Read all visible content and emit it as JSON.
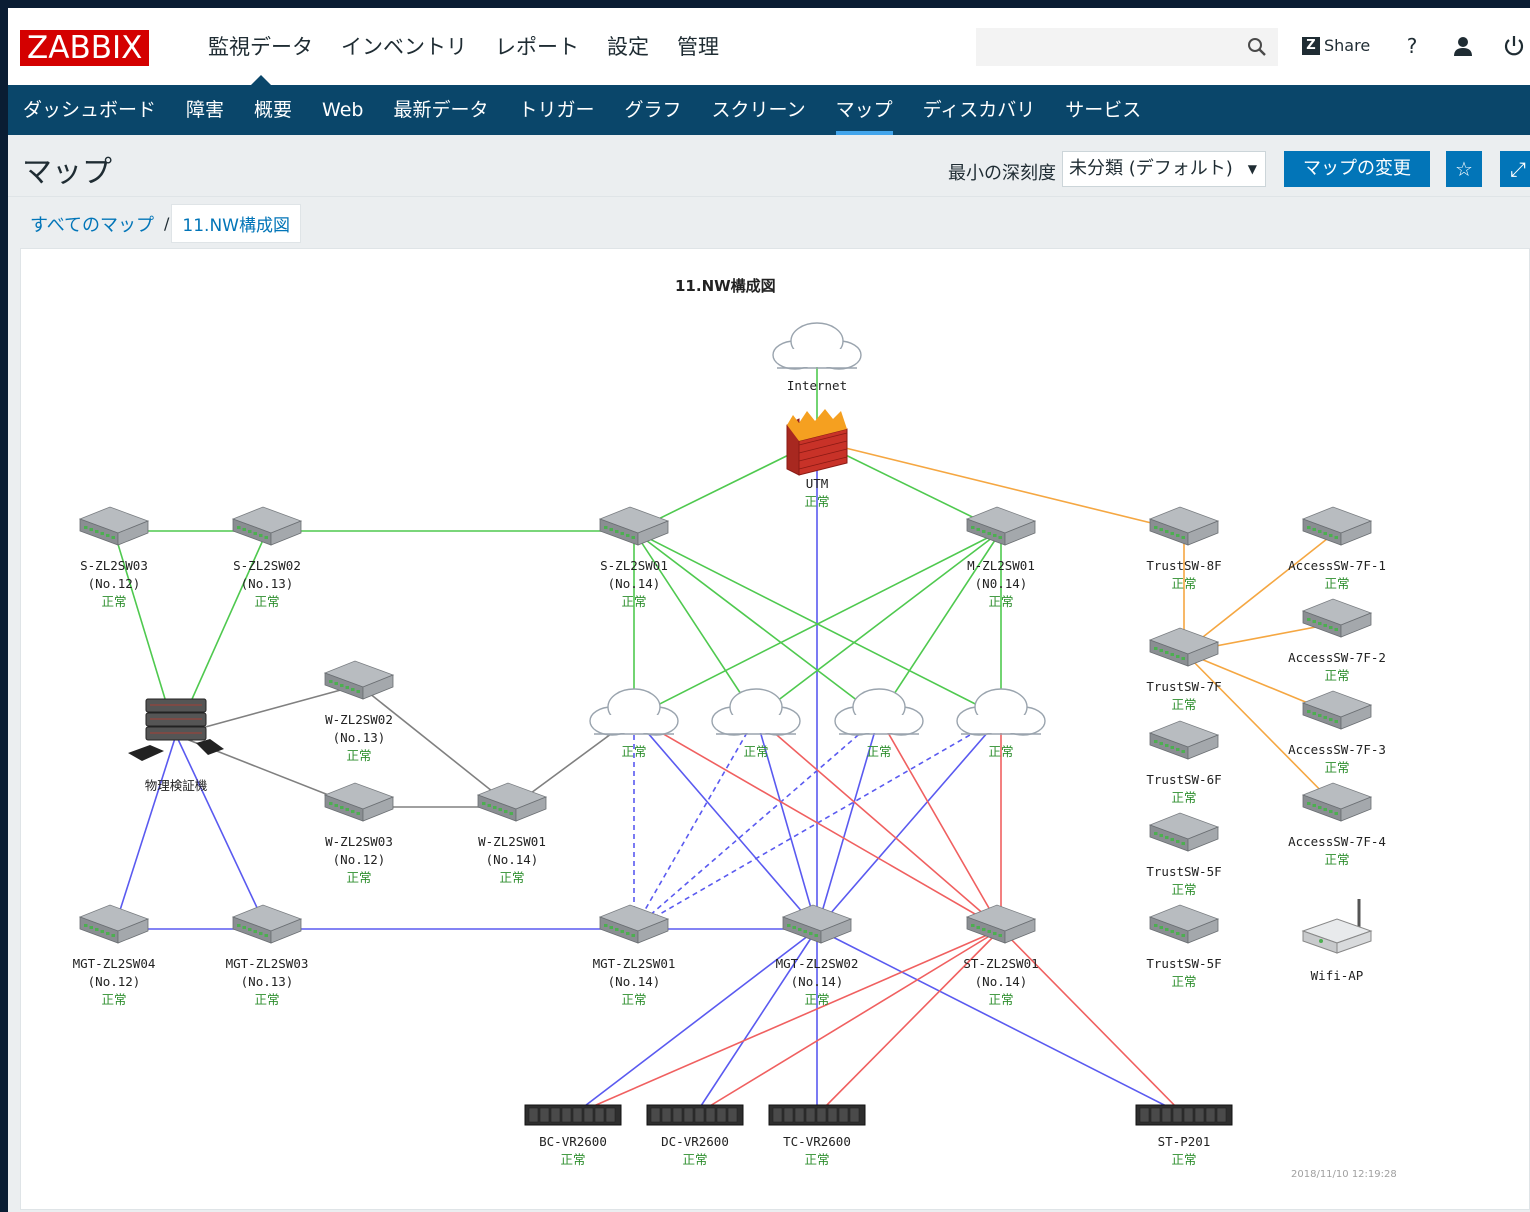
{
  "app": {
    "logo": "ZABBIX",
    "main_menu": [
      "監視データ",
      "インベントリ",
      "レポート",
      "設定",
      "管理"
    ],
    "main_menu_active": 0,
    "search_placeholder": "",
    "share_label": "Share",
    "help_label": "?"
  },
  "sub_menu": {
    "items": [
      "ダッシュボード",
      "障害",
      "概要",
      "Web",
      "最新データ",
      "トリガー",
      "グラフ",
      "スクリーン",
      "マップ",
      "ディスカバリ",
      "サービス"
    ],
    "active": 8
  },
  "header": {
    "title": "マップ",
    "severity_label": "最小の深刻度",
    "severity_value": "未分類 (デフォルト)",
    "change_map_button": "マップの変更"
  },
  "breadcrumb": {
    "all_maps": "すべてのマップ",
    "separator": "/",
    "current": "11.NW構成図"
  },
  "map": {
    "title": "11.NW構成図",
    "timestamp": "2018/11/10 12:19:28",
    "status_ok": "正常",
    "colors": {
      "green": "#4fc94f",
      "orange": "#f5a742",
      "blue": "#5a5af0",
      "red": "#f06060",
      "gray": "#808080",
      "status": "#2f8f2f"
    },
    "nodes": [
      {
        "id": "internet",
        "type": "cloud",
        "lines": [
          "Internet"
        ],
        "status": false
      },
      {
        "id": "utm",
        "type": "firewall",
        "lines": [
          "UTM"
        ],
        "status": true
      },
      {
        "id": "s3",
        "type": "switch",
        "lines": [
          "S-ZL2SW03",
          "(No.12)"
        ],
        "status": true
      },
      {
        "id": "s2",
        "type": "switch",
        "lines": [
          "S-ZL2SW02",
          "(No.13)"
        ],
        "status": true
      },
      {
        "id": "s1",
        "type": "switch",
        "lines": [
          "S-ZL2SW01",
          "(No.14)"
        ],
        "status": true
      },
      {
        "id": "m1",
        "type": "switch",
        "lines": [
          "M-ZL2SW01",
          "(N0.14)"
        ],
        "status": true
      },
      {
        "id": "t8",
        "type": "switch",
        "lines": [
          "TrustSW-8F"
        ],
        "status": true
      },
      {
        "id": "a1",
        "type": "switch",
        "lines": [
          "AccessSW-7F-1"
        ],
        "status": true
      },
      {
        "id": "a2",
        "type": "switch",
        "lines": [
          "AccessSW-7F-2"
        ],
        "status": true
      },
      {
        "id": "t7",
        "type": "switch",
        "lines": [
          "TrustSW-7F"
        ],
        "status": true
      },
      {
        "id": "a3",
        "type": "switch",
        "lines": [
          "AccessSW-7F-3"
        ],
        "status": true
      },
      {
        "id": "t6",
        "type": "switch",
        "lines": [
          "TrustSW-6F"
        ],
        "status": true
      },
      {
        "id": "a4",
        "type": "switch",
        "lines": [
          "AccessSW-7F-4"
        ],
        "status": true
      },
      {
        "id": "t5a",
        "type": "switch",
        "lines": [
          "TrustSW-5F"
        ],
        "status": true
      },
      {
        "id": "t5b",
        "type": "switch",
        "lines": [
          "TrustSW-5F"
        ],
        "status": true
      },
      {
        "id": "wifi",
        "type": "router",
        "lines": [
          "Wifi-AP"
        ],
        "status": false
      },
      {
        "id": "phys",
        "type": "server",
        "lines": [
          "物理検証機"
        ],
        "status": false
      },
      {
        "id": "w2",
        "type": "switch",
        "lines": [
          "W-ZL2SW02",
          "(No.13)"
        ],
        "status": true
      },
      {
        "id": "w3",
        "type": "switch",
        "lines": [
          "W-ZL2SW03",
          "(No.12)"
        ],
        "status": true
      },
      {
        "id": "w1",
        "type": "switch",
        "lines": [
          "W-ZL2SW01",
          "(No.14)"
        ],
        "status": true
      },
      {
        "id": "c1",
        "type": "cloud",
        "lines": [],
        "status": true
      },
      {
        "id": "c2",
        "type": "cloud",
        "lines": [],
        "status": true
      },
      {
        "id": "c3",
        "type": "cloud",
        "lines": [],
        "status": true
      },
      {
        "id": "c4",
        "type": "cloud",
        "lines": [],
        "status": true
      },
      {
        "id": "mg4",
        "type": "switch",
        "lines": [
          "MGT-ZL2SW04",
          "(No.12)"
        ],
        "status": true
      },
      {
        "id": "mg3",
        "type": "switch",
        "lines": [
          "MGT-ZL2SW03",
          "(No.13)"
        ],
        "status": true
      },
      {
        "id": "mg1",
        "type": "switch",
        "lines": [
          "MGT-ZL2SW01",
          "(No.14)"
        ],
        "status": true
      },
      {
        "id": "mg2",
        "type": "switch",
        "lines": [
          "MGT-ZL2SW02",
          "(No.14)"
        ],
        "status": true
      },
      {
        "id": "st1",
        "type": "switch",
        "lines": [
          "ST-ZL2SW01",
          "(No.14)"
        ],
        "status": true
      },
      {
        "id": "bc",
        "type": "rack",
        "lines": [
          "BC-VR2600"
        ],
        "status": true
      },
      {
        "id": "dc",
        "type": "rack",
        "lines": [
          "DC-VR2600"
        ],
        "status": true
      },
      {
        "id": "tc",
        "type": "rack",
        "lines": [
          "TC-VR2600"
        ],
        "status": true
      },
      {
        "id": "stp",
        "type": "rack",
        "lines": [
          "ST-P201"
        ],
        "status": true
      }
    ],
    "links": [
      [
        "internet",
        "utm",
        "green",
        false
      ],
      [
        "utm",
        "s1",
        "green",
        false
      ],
      [
        "utm",
        "m1",
        "green",
        false
      ],
      [
        "utm",
        "t8",
        "orange",
        false
      ],
      [
        "utm",
        "mg2",
        "blue",
        false
      ],
      [
        "s3",
        "s2",
        "green",
        false
      ],
      [
        "s2",
        "s1",
        "green",
        false
      ],
      [
        "s3",
        "phys",
        "green",
        false
      ],
      [
        "s2",
        "phys",
        "green",
        false
      ],
      [
        "s1",
        "c1",
        "green",
        false
      ],
      [
        "s1",
        "c2",
        "green",
        false
      ],
      [
        "s1",
        "c3",
        "green",
        false
      ],
      [
        "s1",
        "c4",
        "green",
        false
      ],
      [
        "m1",
        "c1",
        "green",
        false
      ],
      [
        "m1",
        "c2",
        "green",
        false
      ],
      [
        "m1",
        "c3",
        "green",
        false
      ],
      [
        "m1",
        "c4",
        "green",
        false
      ],
      [
        "t8",
        "t7",
        "orange",
        false
      ],
      [
        "t7",
        "a1",
        "orange",
        false
      ],
      [
        "t7",
        "a2",
        "orange",
        false
      ],
      [
        "t7",
        "a3",
        "orange",
        false
      ],
      [
        "t7",
        "a4",
        "orange",
        false
      ],
      [
        "phys",
        "w2",
        "gray",
        false
      ],
      [
        "phys",
        "w3",
        "gray",
        false
      ],
      [
        "w2",
        "w1",
        "gray",
        false
      ],
      [
        "w3",
        "w1",
        "gray",
        false
      ],
      [
        "w1",
        "c1",
        "gray",
        false
      ],
      [
        "phys",
        "mg4",
        "blue",
        false
      ],
      [
        "phys",
        "mg3",
        "blue",
        false
      ],
      [
        "mg4",
        "mg3",
        "blue",
        false
      ],
      [
        "mg3",
        "mg1",
        "blue",
        false
      ],
      [
        "mg1",
        "mg2",
        "blue",
        false
      ],
      [
        "c1",
        "mg1",
        "blue",
        true
      ],
      [
        "c2",
        "mg1",
        "blue",
        true
      ],
      [
        "c3",
        "mg1",
        "blue",
        true
      ],
      [
        "c4",
        "mg1",
        "blue",
        true
      ],
      [
        "c1",
        "mg2",
        "blue",
        false
      ],
      [
        "c2",
        "mg2",
        "blue",
        false
      ],
      [
        "c3",
        "mg2",
        "blue",
        false
      ],
      [
        "c4",
        "mg2",
        "blue",
        false
      ],
      [
        "c1",
        "st1",
        "red",
        false
      ],
      [
        "c2",
        "st1",
        "red",
        false
      ],
      [
        "c3",
        "st1",
        "red",
        false
      ],
      [
        "c4",
        "st1",
        "red",
        false
      ],
      [
        "mg2",
        "bc",
        "blue",
        false
      ],
      [
        "mg2",
        "dc",
        "blue",
        false
      ],
      [
        "mg2",
        "tc",
        "blue",
        false
      ],
      [
        "mg2",
        "stp",
        "blue",
        false
      ],
      [
        "st1",
        "bc",
        "red",
        false
      ],
      [
        "st1",
        "dc",
        "red",
        false
      ],
      [
        "st1",
        "tc",
        "red",
        false
      ],
      [
        "st1",
        "stp",
        "red",
        false
      ]
    ]
  }
}
